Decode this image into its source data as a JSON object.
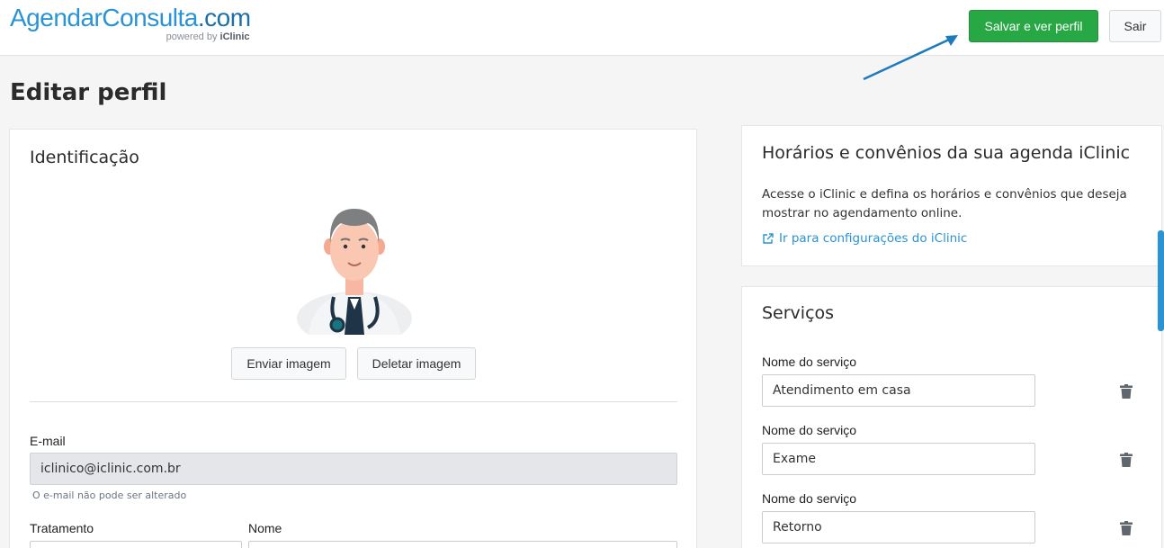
{
  "header": {
    "logo_part1": "AgendarConsulta",
    "logo_part2": ".com",
    "logo_powered": "powered by",
    "logo_brand": "iClinic",
    "save_label": "Salvar e ver perfil",
    "exit_label": "Sair"
  },
  "page": {
    "title": "Editar perfil"
  },
  "identification": {
    "title": "Identificação",
    "upload_label": "Enviar imagem",
    "delete_label": "Deletar imagem",
    "email_label": "E-mail",
    "email_value": "iclinico@iclinic.com.br",
    "email_hint": "O e-mail não pode ser alterado",
    "treatment_label": "Tratamento",
    "name_label": "Nome"
  },
  "schedule": {
    "title": "Horários e convênios da sua agenda iClinic",
    "description": "Acesse o iClinic e defina os horários e convênios que deseja mostrar no agendamento online.",
    "link_label": "Ir para configurações do iClinic"
  },
  "services": {
    "title": "Serviços",
    "items": [
      {
        "label": "Nome do serviço",
        "value": "Atendimento em casa"
      },
      {
        "label": "Nome do serviço",
        "value": "Exame"
      },
      {
        "label": "Nome do serviço",
        "value": "Retorno"
      }
    ]
  },
  "colors": {
    "primary": "#2a93d5",
    "success": "#28a745"
  },
  "icons": [
    "external-link-icon",
    "trash-icon",
    "doctor-avatar"
  ]
}
